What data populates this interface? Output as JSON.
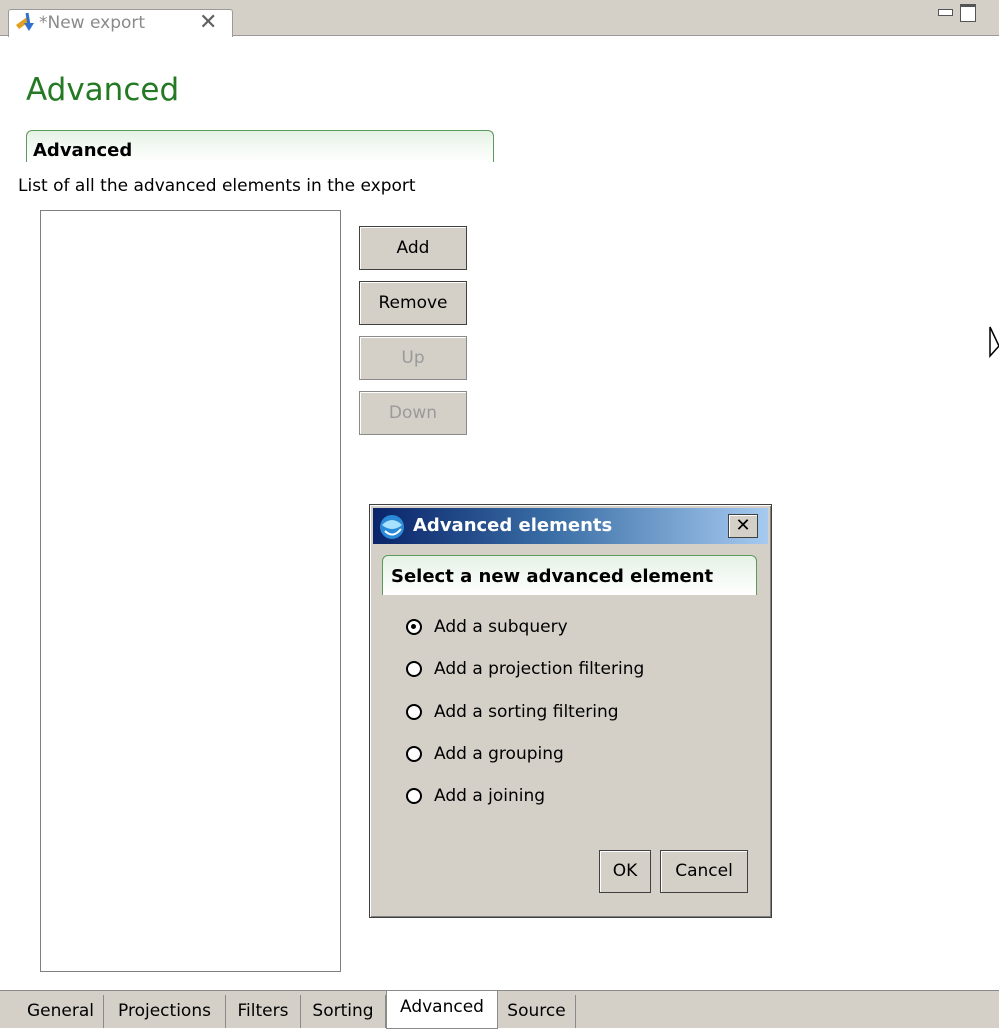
{
  "editor_tab": {
    "title": "*New export",
    "close_symbol": "✕"
  },
  "page": {
    "title": "Advanced",
    "section_title": "Advanced",
    "section_description": "List of all the advanced elements in the export"
  },
  "buttons": {
    "add": "Add",
    "remove": "Remove",
    "up": "Up",
    "down": "Down"
  },
  "dialog": {
    "title": "Advanced elements",
    "close_symbol": "✕",
    "heading": "Select a new advanced element",
    "options": [
      {
        "label": "Add a subquery",
        "checked": true
      },
      {
        "label": "Add a projection filtering",
        "checked": false
      },
      {
        "label": "Add a sorting filtering",
        "checked": false
      },
      {
        "label": "Add a grouping",
        "checked": false
      },
      {
        "label": "Add a joining",
        "checked": false
      }
    ],
    "ok": "OK",
    "cancel": "Cancel"
  },
  "bottom_tabs": [
    "General",
    "Projections",
    "Filters",
    "Sorting",
    "Advanced",
    "Source"
  ],
  "active_bottom_tab": "Advanced",
  "colors": {
    "title_green": "#237a23",
    "dialog_title_blue": "#0a246a",
    "chrome": "#d4d0c8"
  }
}
